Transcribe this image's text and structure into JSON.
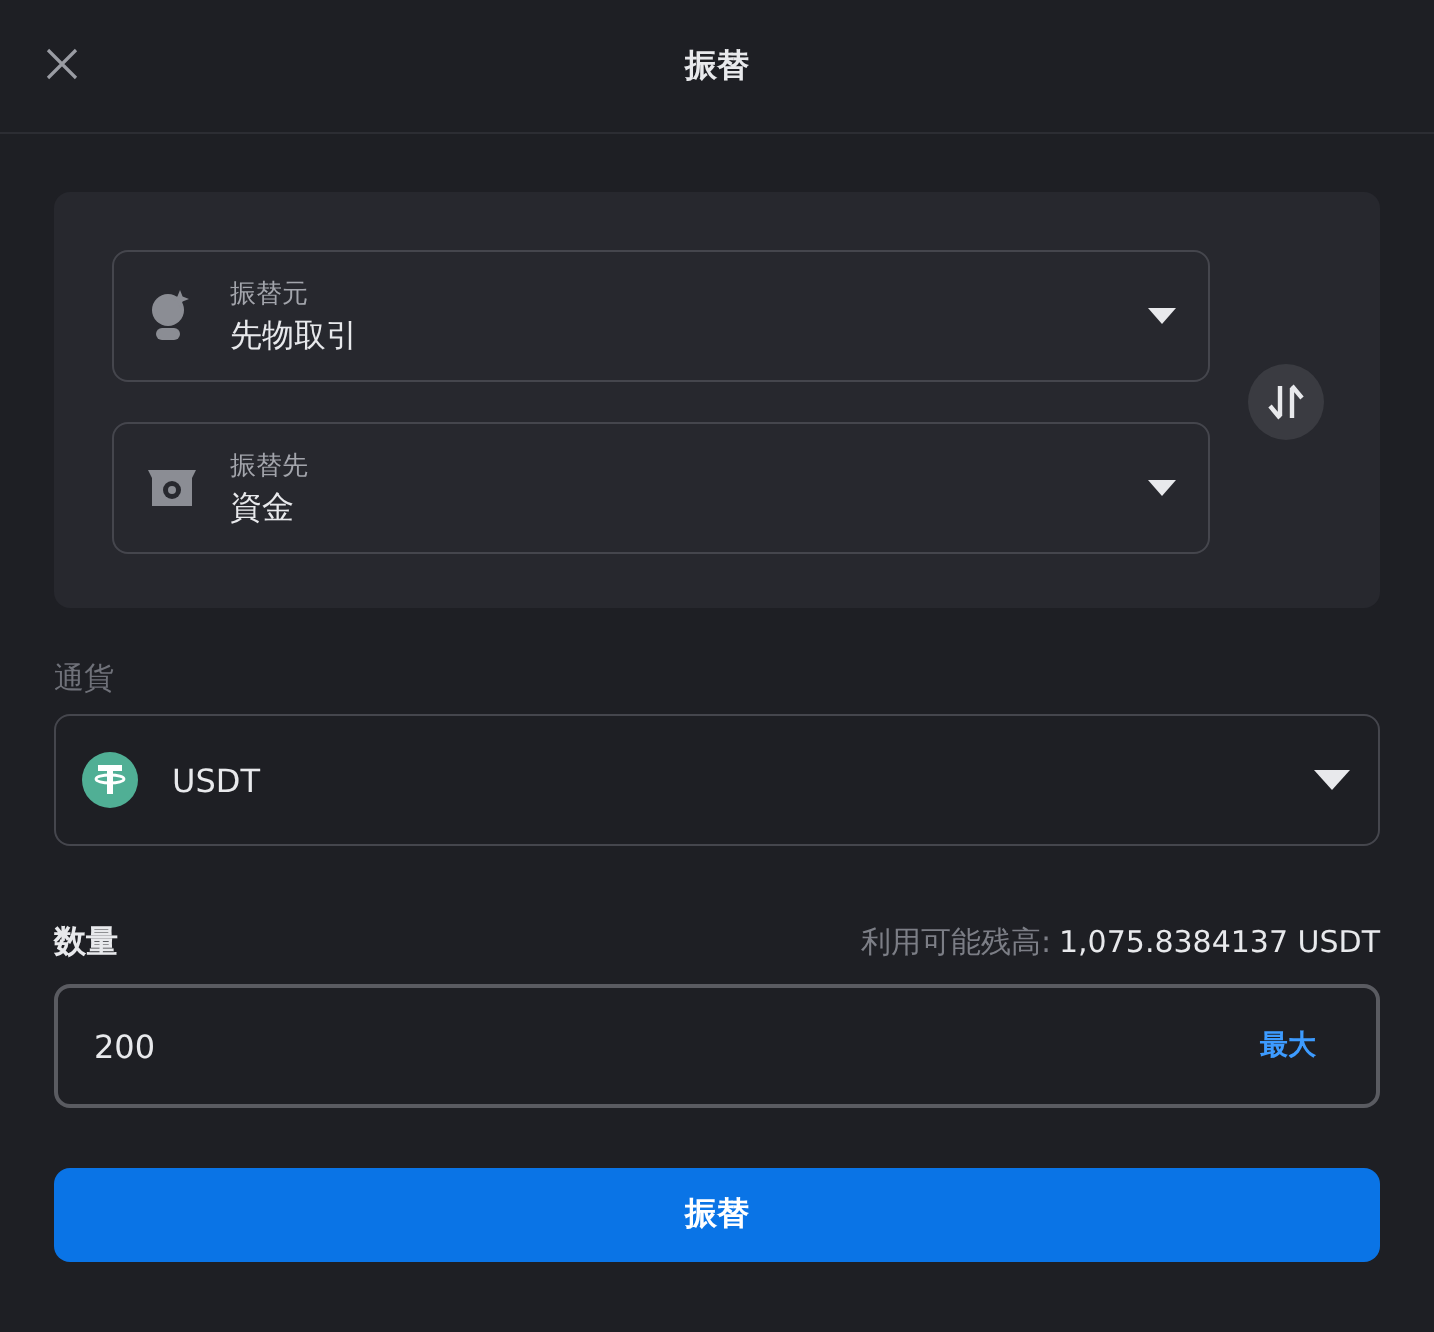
{
  "header": {
    "title": "振替"
  },
  "transfer": {
    "accounts": [
      {
        "kind": "from",
        "label": "振替元",
        "value": "先物取引"
      },
      {
        "kind": "to",
        "label": "振替先",
        "value": "資金"
      }
    ]
  },
  "currency": {
    "label": "通貨",
    "value": "USDT"
  },
  "amount": {
    "label": "数量",
    "balance_label": "利用可能残高:",
    "balance_value": "1,075.8384137 USDT",
    "value": "200",
    "max": "最大"
  },
  "submit": "振替"
}
